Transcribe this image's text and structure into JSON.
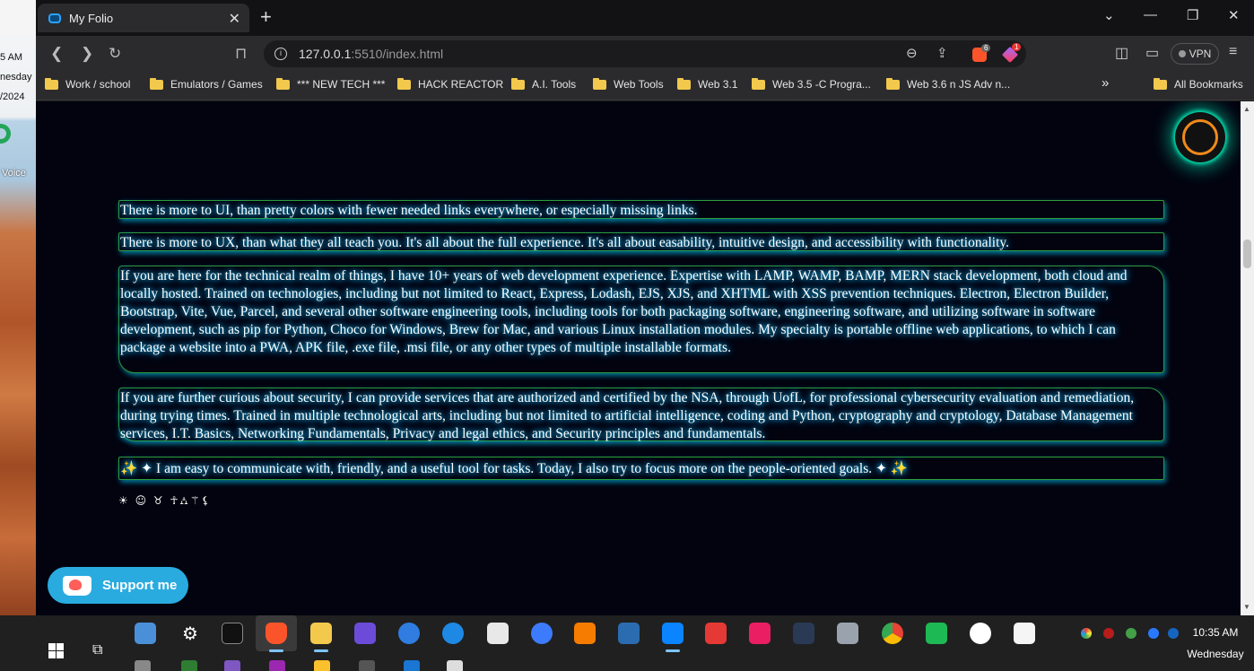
{
  "desktop": {
    "time_fragment": "5 AM",
    "day_fragment": "nesday",
    "date_fragment": "/2024",
    "shortcut_label": "Voice"
  },
  "browser": {
    "tab_title": "My Folio",
    "new_tab_symbol": "+",
    "url_host": "127.0.0.1",
    "url_rest": ":5510/index.html",
    "shields_count": "6",
    "rewards_count": "1",
    "vpn_label": "VPN",
    "bookmarks": [
      "Work / school",
      "Emulators / Games",
      "*** NEW TECH ***",
      "HACK REACTOR",
      "A.I. Tools",
      "Web Tools",
      "Web 3.1",
      "Web 3.5  -C Progra...",
      "Web 3.6 n JS Adv n..."
    ],
    "overflow_symbol": "»",
    "all_bookmarks_label": "All Bookmarks"
  },
  "page": {
    "paragraphs": [
      "There is more to UI, than pretty colors with fewer needed links everywhere, or especially missing links.",
      "There is more to UX, than what they all teach you. It's all about the full experience. It's all about easability, intuitive design, and accessibility with functionality.",
      "If you are here for the technical realm of things, I have 10+ years of web development experience. Expertise with LAMP, WAMP, BAMP, MERN stack development, both cloud and locally hosted. Trained on technologies, including but not limited to React, Express, Lodash, EJS, XJS, and XHTML with XSS prevention techniques. Electron, Electron Builder, Bootstrap, Vite, Vue, Parcel, and several other software engineering tools, including tools for both packaging software, engineering software, and utilizing software in software development, such as pip for Python, Choco for Windows, Brew for Mac, and various Linux installation modules. My specialty is portable offline web applications, to which I can package a website into a PWA, APK file, .exe file, .msi file, or any other types of multiple installable formats.",
      "If you are further curious about security, I can provide services that are authorized and certified by the NSA, through UofL, for professional cybersecurity evaluation and remediation, during trying times. Trained in multiple technological arts, including but not limited to artificial intelligence, coding and Python, cryptography and cryptology, Database Management services, I.T. Basics, Networking Fundamentals, Privacy and legal ethics, and Security principles and fundamentals.",
      "✨ ✦ I am easy to communicate with, friendly, and a useful tool for tasks. Today, I also try to focus more on the people-oriented goals. ✦ ✨"
    ],
    "symbols": "☀ ☺ ♉ ☥⛼⚚⚸",
    "support_label": "Support me"
  },
  "taskbar": {
    "time": "10:35 AM",
    "day": "Wednesday"
  },
  "colors": {
    "page_bg": "#02030f",
    "glow": "#1ec8ff",
    "border": "#2e9c3a",
    "support": "#29abe0",
    "orb_ring": "#f08a1a"
  }
}
